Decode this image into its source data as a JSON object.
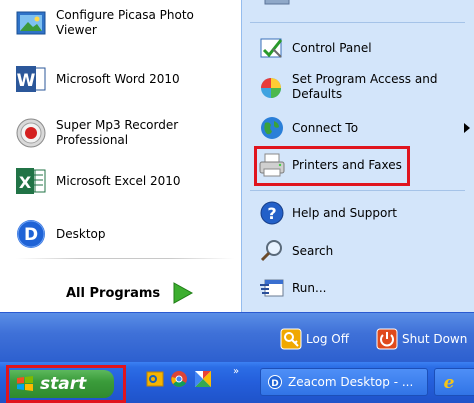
{
  "left": {
    "items": [
      {
        "label_line1": "Configure Picasa Photo",
        "label_line2": "Viewer",
        "icon": "picasa-photo-viewer-icon"
      },
      {
        "label_line1": "Microsoft Word 2010",
        "label_line2": "",
        "icon": "microsoft-word-icon"
      },
      {
        "label_line1": "Super Mp3 Recorder",
        "label_line2": "Professional",
        "icon": "mp3-recorder-icon"
      },
      {
        "label_line1": "Microsoft Excel 2010",
        "label_line2": "",
        "icon": "microsoft-excel-icon"
      },
      {
        "label_line1": "Desktop",
        "label_line2": "",
        "icon": "desktop-d-icon"
      }
    ],
    "all_programs": "All Programs"
  },
  "right": {
    "items": [
      {
        "label_line1": "Control Panel",
        "label_line2": "",
        "icon": "control-panel-icon"
      },
      {
        "label_line1": "Set Program Access and",
        "label_line2": "Defaults",
        "icon": "program-access-icon"
      },
      {
        "label_line1": "Connect To",
        "label_line2": "",
        "icon": "connect-to-globe-icon"
      },
      {
        "label_line1": "Printers and Faxes",
        "label_line2": "",
        "icon": "printer-icon"
      },
      {
        "label_line1": "Help and Support",
        "label_line2": "",
        "icon": "help-icon"
      },
      {
        "label_line1": "Search",
        "label_line2": "",
        "icon": "search-icon"
      },
      {
        "label_line1": "Run...",
        "label_line2": "",
        "icon": "run-icon"
      }
    ],
    "highlighted": "Printers and Faxes"
  },
  "bottom": {
    "log_off": "Log Off",
    "shut_down": "Shut Down"
  },
  "taskbar": {
    "start": "start",
    "quick_launch": [
      "outlook-icon",
      "chrome-icon",
      "picasa-icon"
    ],
    "overflow": "»",
    "tasks": [
      {
        "label": "Zeacom Desktop - ...",
        "icon": "zeacom-icon"
      },
      {
        "label": "",
        "icon": "internet-explorer-icon"
      }
    ]
  },
  "colors": {
    "highlight_red": "#e0141e",
    "start_green": "#3b9c3b",
    "taskbar_blue": "#245edb",
    "right_panel": "#d3e5fa"
  }
}
